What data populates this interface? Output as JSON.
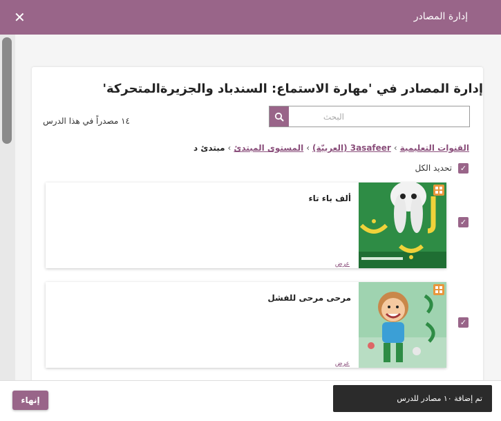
{
  "header": {
    "title": "إدارة المصادر",
    "close_glyph": "✕"
  },
  "main": {
    "heading": "إدارة المصادر في 'مهارة الاستماع: السندباد والجزيرةالمتحركة'",
    "search": {
      "placeholder": "البحث",
      "value": ""
    },
    "resource_count": "١٤ مصدراً في هذا الدرس",
    "breadcrumb": {
      "items": [
        "القنوات التعليمية",
        "3asafeer (العربيّة)",
        "المستوى المبتدئ"
      ],
      "current": "مبتدئ د",
      "separator": "›"
    },
    "select_all": {
      "label": "تحديد الكل",
      "checked": true
    },
    "resources": [
      {
        "title": "ألف باء تاء",
        "view_label": "عرض",
        "checked": true,
        "thumb_icon": "alphabet-book-cover"
      },
      {
        "title": "مرحى مرحى للفشل",
        "view_label": "عرض",
        "checked": true,
        "thumb_icon": "happy-child-book-cover"
      }
    ]
  },
  "footer": {
    "finish_label": "إنهاء",
    "toast": "تم إضافة ١٠ مصادر للدرس"
  },
  "colors": {
    "accent": "#996589",
    "badge": "#e8963c",
    "toast_bg": "#2b2b2b"
  }
}
